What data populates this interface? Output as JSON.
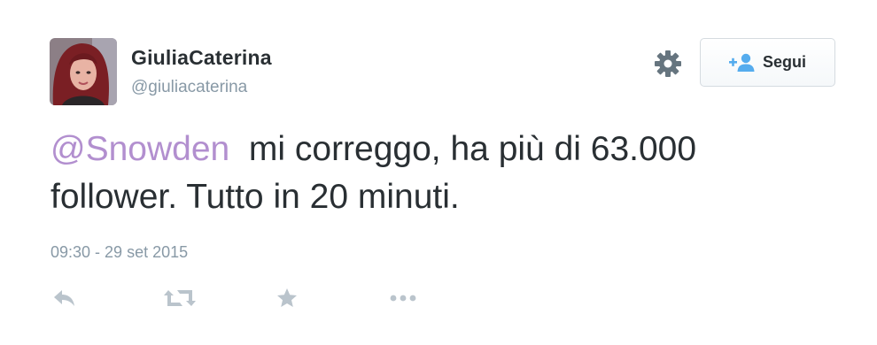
{
  "user": {
    "display_name": "GiuliaCaterina",
    "handle": "@giuliacaterina"
  },
  "follow_button": {
    "label": "Segui"
  },
  "tweet": {
    "mention": "@Snowden",
    "text": "  mi correggo, ha più di 63.000 follower. Tutto in 20 minuti.",
    "timestamp": "09:30 - 29 set 2015"
  },
  "colors": {
    "mention": "#b28fcf",
    "icon_gray": "#bac4cc",
    "follow_icon": "#55acee",
    "text": "#292f33",
    "muted": "#8899a6"
  },
  "icons": {
    "gear": "gear-icon",
    "follow": "follow-person-icon",
    "reply": "reply-icon",
    "retweet": "retweet-icon",
    "favorite": "star-icon",
    "more": "more-dots-icon"
  }
}
